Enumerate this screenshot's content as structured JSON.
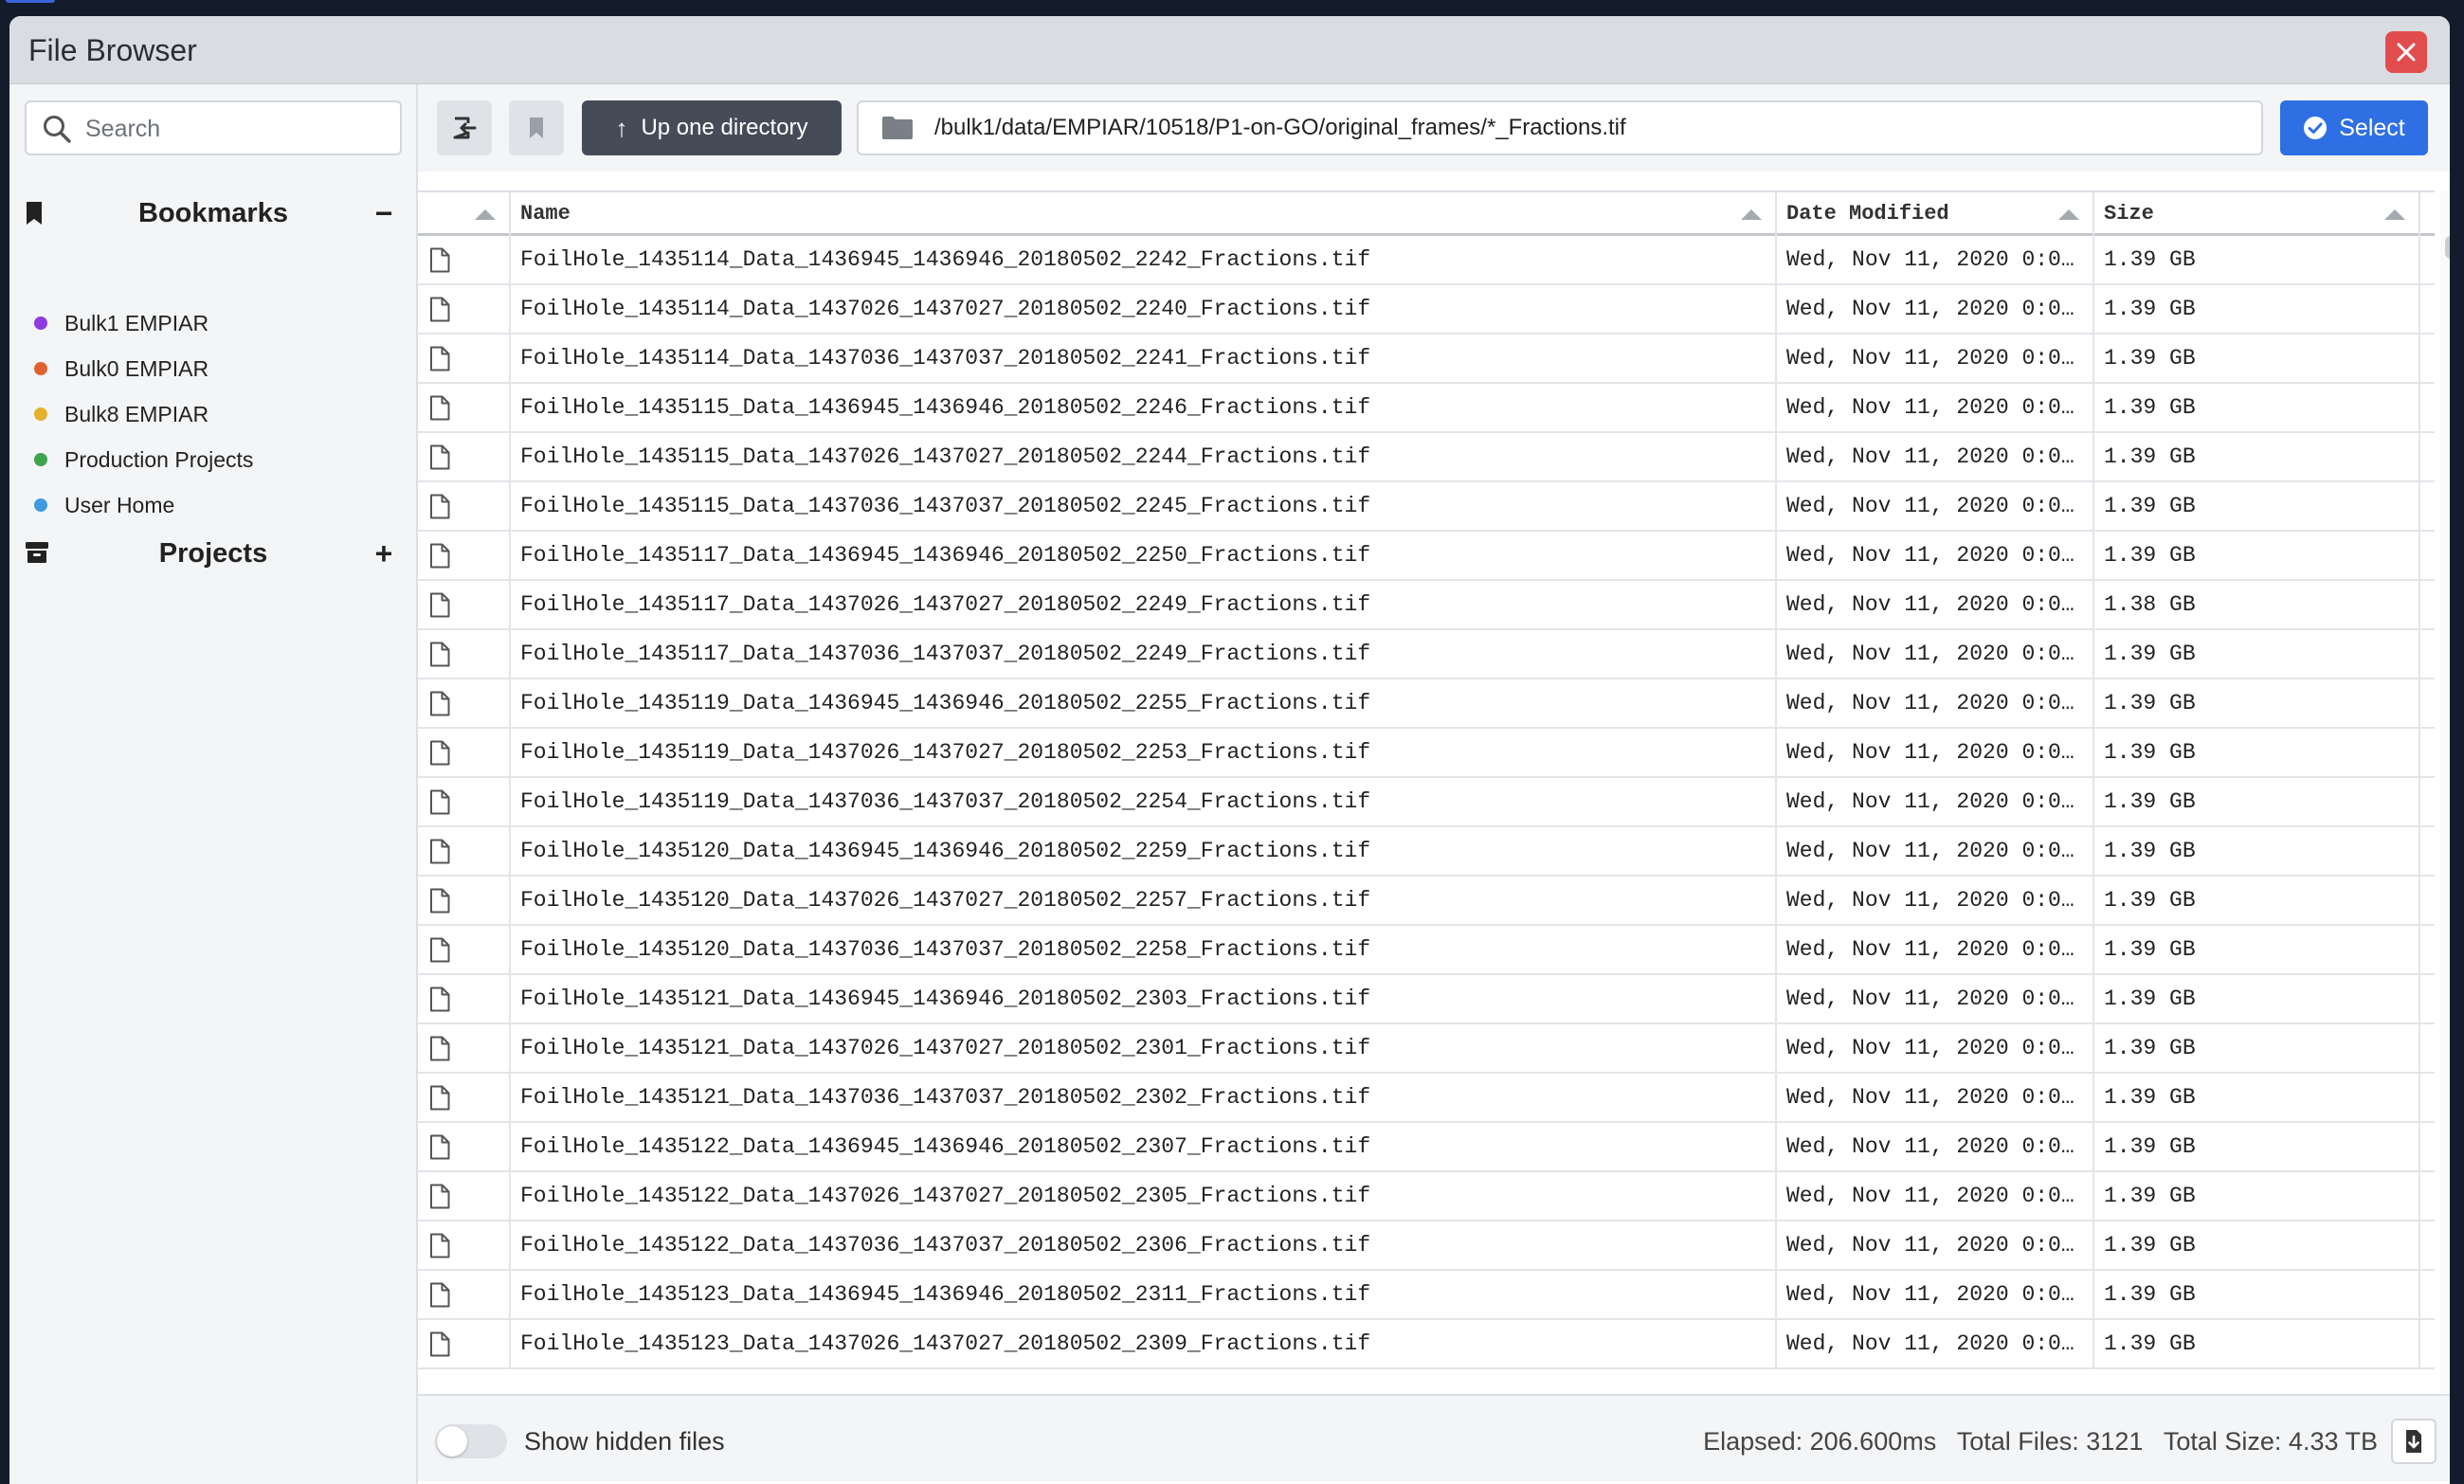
{
  "window": {
    "title": "File Browser"
  },
  "sidebar": {
    "search_placeholder": "Search",
    "bookmarks_title": "Bookmarks",
    "bookmarks_action": "−",
    "bookmarks": [
      {
        "label": "Bulk1 EMPIAR",
        "color": "#8b3de0"
      },
      {
        "label": "Bulk0 EMPIAR",
        "color": "#e0612d"
      },
      {
        "label": "Bulk8 EMPIAR",
        "color": "#e3b030"
      },
      {
        "label": "Production Projects",
        "color": "#3fa34d"
      },
      {
        "label": "User Home",
        "color": "#3f9be0"
      }
    ],
    "projects_title": "Projects",
    "projects_action": "+"
  },
  "toolbar": {
    "up_label": "Up one directory",
    "path": "/bulk1/data/EMPIAR/10518/P1-on-GO/original_frames/*_Fractions.tif",
    "select_label": "Select"
  },
  "table": {
    "columns": [
      "Name",
      "Date Modified",
      "Size"
    ],
    "rows": [
      {
        "name": "FoilHole_1435114_Data_1436945_1436946_20180502_2242_Fractions.tif",
        "date": "Wed, Nov 11, 2020 0:00…",
        "size": "1.39 GB"
      },
      {
        "name": "FoilHole_1435114_Data_1437026_1437027_20180502_2240_Fractions.tif",
        "date": "Wed, Nov 11, 2020 0:00…",
        "size": "1.39 GB"
      },
      {
        "name": "FoilHole_1435114_Data_1437036_1437037_20180502_2241_Fractions.tif",
        "date": "Wed, Nov 11, 2020 0:00…",
        "size": "1.39 GB"
      },
      {
        "name": "FoilHole_1435115_Data_1436945_1436946_20180502_2246_Fractions.tif",
        "date": "Wed, Nov 11, 2020 0:00…",
        "size": "1.39 GB"
      },
      {
        "name": "FoilHole_1435115_Data_1437026_1437027_20180502_2244_Fractions.tif",
        "date": "Wed, Nov 11, 2020 0:00…",
        "size": "1.39 GB"
      },
      {
        "name": "FoilHole_1435115_Data_1437036_1437037_20180502_2245_Fractions.tif",
        "date": "Wed, Nov 11, 2020 0:00…",
        "size": "1.39 GB"
      },
      {
        "name": "FoilHole_1435117_Data_1436945_1436946_20180502_2250_Fractions.tif",
        "date": "Wed, Nov 11, 2020 0:00…",
        "size": "1.39 GB"
      },
      {
        "name": "FoilHole_1435117_Data_1437026_1437027_20180502_2249_Fractions.tif",
        "date": "Wed, Nov 11, 2020 0:00…",
        "size": "1.38 GB"
      },
      {
        "name": "FoilHole_1435117_Data_1437036_1437037_20180502_2249_Fractions.tif",
        "date": "Wed, Nov 11, 2020 0:00…",
        "size": "1.39 GB"
      },
      {
        "name": "FoilHole_1435119_Data_1436945_1436946_20180502_2255_Fractions.tif",
        "date": "Wed, Nov 11, 2020 0:00…",
        "size": "1.39 GB"
      },
      {
        "name": "FoilHole_1435119_Data_1437026_1437027_20180502_2253_Fractions.tif",
        "date": "Wed, Nov 11, 2020 0:00…",
        "size": "1.39 GB"
      },
      {
        "name": "FoilHole_1435119_Data_1437036_1437037_20180502_2254_Fractions.tif",
        "date": "Wed, Nov 11, 2020 0:00…",
        "size": "1.39 GB"
      },
      {
        "name": "FoilHole_1435120_Data_1436945_1436946_20180502_2259_Fractions.tif",
        "date": "Wed, Nov 11, 2020 0:00…",
        "size": "1.39 GB"
      },
      {
        "name": "FoilHole_1435120_Data_1437026_1437027_20180502_2257_Fractions.tif",
        "date": "Wed, Nov 11, 2020 0:00…",
        "size": "1.39 GB"
      },
      {
        "name": "FoilHole_1435120_Data_1437036_1437037_20180502_2258_Fractions.tif",
        "date": "Wed, Nov 11, 2020 0:00…",
        "size": "1.39 GB"
      },
      {
        "name": "FoilHole_1435121_Data_1436945_1436946_20180502_2303_Fractions.tif",
        "date": "Wed, Nov 11, 2020 0:00…",
        "size": "1.39 GB"
      },
      {
        "name": "FoilHole_1435121_Data_1437026_1437027_20180502_2301_Fractions.tif",
        "date": "Wed, Nov 11, 2020 0:00…",
        "size": "1.39 GB"
      },
      {
        "name": "FoilHole_1435121_Data_1437036_1437037_20180502_2302_Fractions.tif",
        "date": "Wed, Nov 11, 2020 0:00…",
        "size": "1.39 GB"
      },
      {
        "name": "FoilHole_1435122_Data_1436945_1436946_20180502_2307_Fractions.tif",
        "date": "Wed, Nov 11, 2020 0:00…",
        "size": "1.39 GB"
      },
      {
        "name": "FoilHole_1435122_Data_1437026_1437027_20180502_2305_Fractions.tif",
        "date": "Wed, Nov 11, 2020 0:00…",
        "size": "1.39 GB"
      },
      {
        "name": "FoilHole_1435122_Data_1437036_1437037_20180502_2306_Fractions.tif",
        "date": "Wed, Nov 11, 2020 0:00…",
        "size": "1.39 GB"
      },
      {
        "name": "FoilHole_1435123_Data_1436945_1436946_20180502_2311_Fractions.tif",
        "date": "Wed, Nov 11, 2020 0:00…",
        "size": "1.39 GB"
      },
      {
        "name": "FoilHole_1435123_Data_1437026_1437027_20180502_2309_Fractions.tif",
        "date": "Wed, Nov 11, 2020 0:00…",
        "size": "1.39 GB"
      }
    ]
  },
  "footer": {
    "show_hidden_label": "Show hidden files",
    "show_hidden": false,
    "elapsed": "Elapsed: 206.600ms",
    "total_files": "Total Files: 3121",
    "total_size": "Total Size: 4.33 TB"
  },
  "icons": {
    "close": "close-icon",
    "search": "search-icon",
    "bookmark": "bookmark-icon",
    "archive": "archive-icon",
    "back": "back-icon",
    "folder": "folder-icon",
    "check": "check-circle-icon",
    "file": "file-icon",
    "download": "download-icon"
  },
  "colors": {
    "accent": "#2f6fe4",
    "close": "#e14d4d",
    "up_button": "#464c57"
  }
}
